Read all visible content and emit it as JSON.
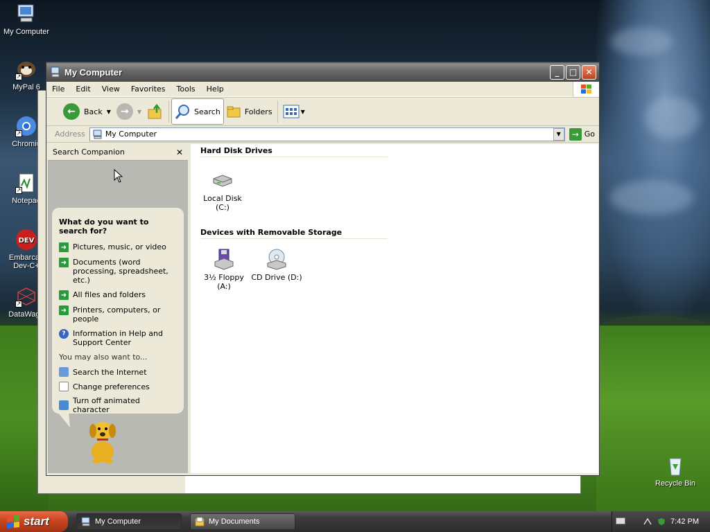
{
  "desktop": {
    "icons": [
      {
        "label": "My Computer",
        "icon": "my-computer-icon"
      },
      {
        "label": "MyPal 6",
        "icon": "mypal-icon"
      },
      {
        "label": "Chromiu",
        "icon": "chromium-icon"
      },
      {
        "label": "Notepad",
        "icon": "notepad-icon"
      },
      {
        "label": "Embarcad Dev-C+",
        "icon": "devcpp-icon"
      },
      {
        "label": "DataWago",
        "icon": "datawagon-icon"
      }
    ],
    "recycle_bin": {
      "label": "Recycle Bin",
      "icon": "recycle-bin-icon"
    }
  },
  "window": {
    "title": "My Computer",
    "menu": [
      "File",
      "Edit",
      "View",
      "Favorites",
      "Tools",
      "Help"
    ],
    "toolbar": {
      "back": "Back",
      "search": "Search",
      "folders": "Folders"
    },
    "address": {
      "label": "Address",
      "value": "My Computer",
      "go": "Go"
    }
  },
  "companion": {
    "header": "Search Companion",
    "question": "What do you want to search for?",
    "options": [
      "Pictures, music, or video",
      "Documents (word processing, spreadsheet, etc.)",
      "All files and folders",
      "Printers, computers, or people",
      "Information in Help and Support Center"
    ],
    "also_label": "You may also want to...",
    "links": [
      "Search the Internet",
      "Change preferences",
      "Turn off animated character"
    ]
  },
  "files": {
    "groups": [
      {
        "title": "Hard Disk Drives",
        "items": [
          {
            "label": "Local Disk (C:)",
            "icon": "hard-disk-icon"
          }
        ]
      },
      {
        "title": "Devices with Removable Storage",
        "items": [
          {
            "label": "3½ Floppy (A:)",
            "icon": "floppy-icon"
          },
          {
            "label": "CD Drive (D:)",
            "icon": "cd-drive-icon"
          }
        ]
      }
    ]
  },
  "taskbar": {
    "start": "start",
    "tasks": [
      "My Computer",
      "My Documents"
    ],
    "clock": "7:42 PM"
  },
  "colors": {
    "start_button": "#c9451e",
    "go_green": "#3a9a3a",
    "companion_bg": "#b9b9b4"
  }
}
